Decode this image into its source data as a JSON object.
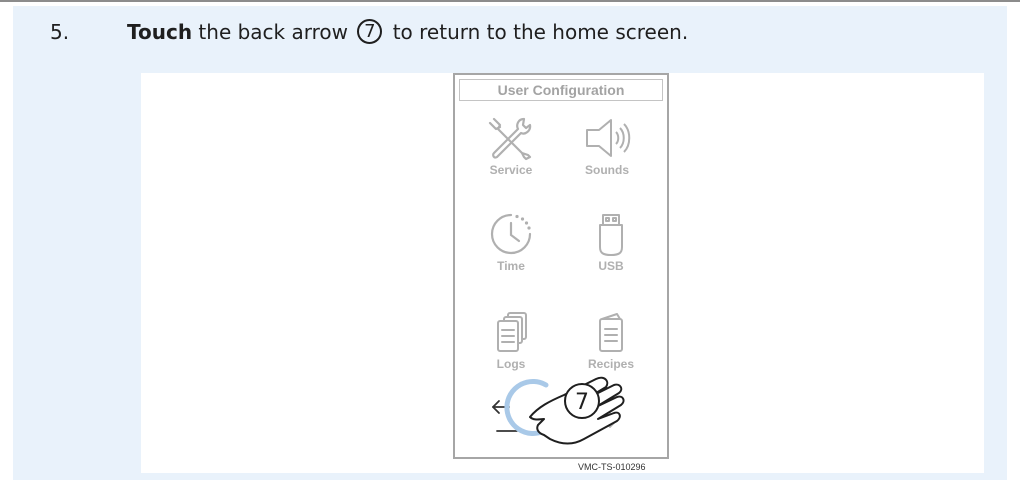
{
  "step": {
    "number": "5.",
    "action_bold": "Touch",
    "text_before_callout": " the back arrow",
    "callout": "7",
    "text_after_callout": " to return to the home screen."
  },
  "device": {
    "title": "User Configuration",
    "tiles": [
      {
        "label": "Service",
        "icon": "service-icon"
      },
      {
        "label": "Sounds",
        "icon": "speaker-icon"
      },
      {
        "label": "Time",
        "icon": "clock-icon"
      },
      {
        "label": "USB",
        "icon": "usb-icon"
      },
      {
        "label": "Logs",
        "icon": "logs-icon"
      },
      {
        "label": "Recipes",
        "icon": "recipes-icon"
      }
    ],
    "back_icon": "back-arrow-icon",
    "down_icon": "down-arrow-icon"
  },
  "figure": {
    "callout_number": "7",
    "figure_id": "VMC-TS-010296"
  },
  "colors": {
    "panel_background": "#e9f2fb",
    "touch_highlight": "#a9c9e8",
    "icon_gray": "#b0b0b0"
  }
}
